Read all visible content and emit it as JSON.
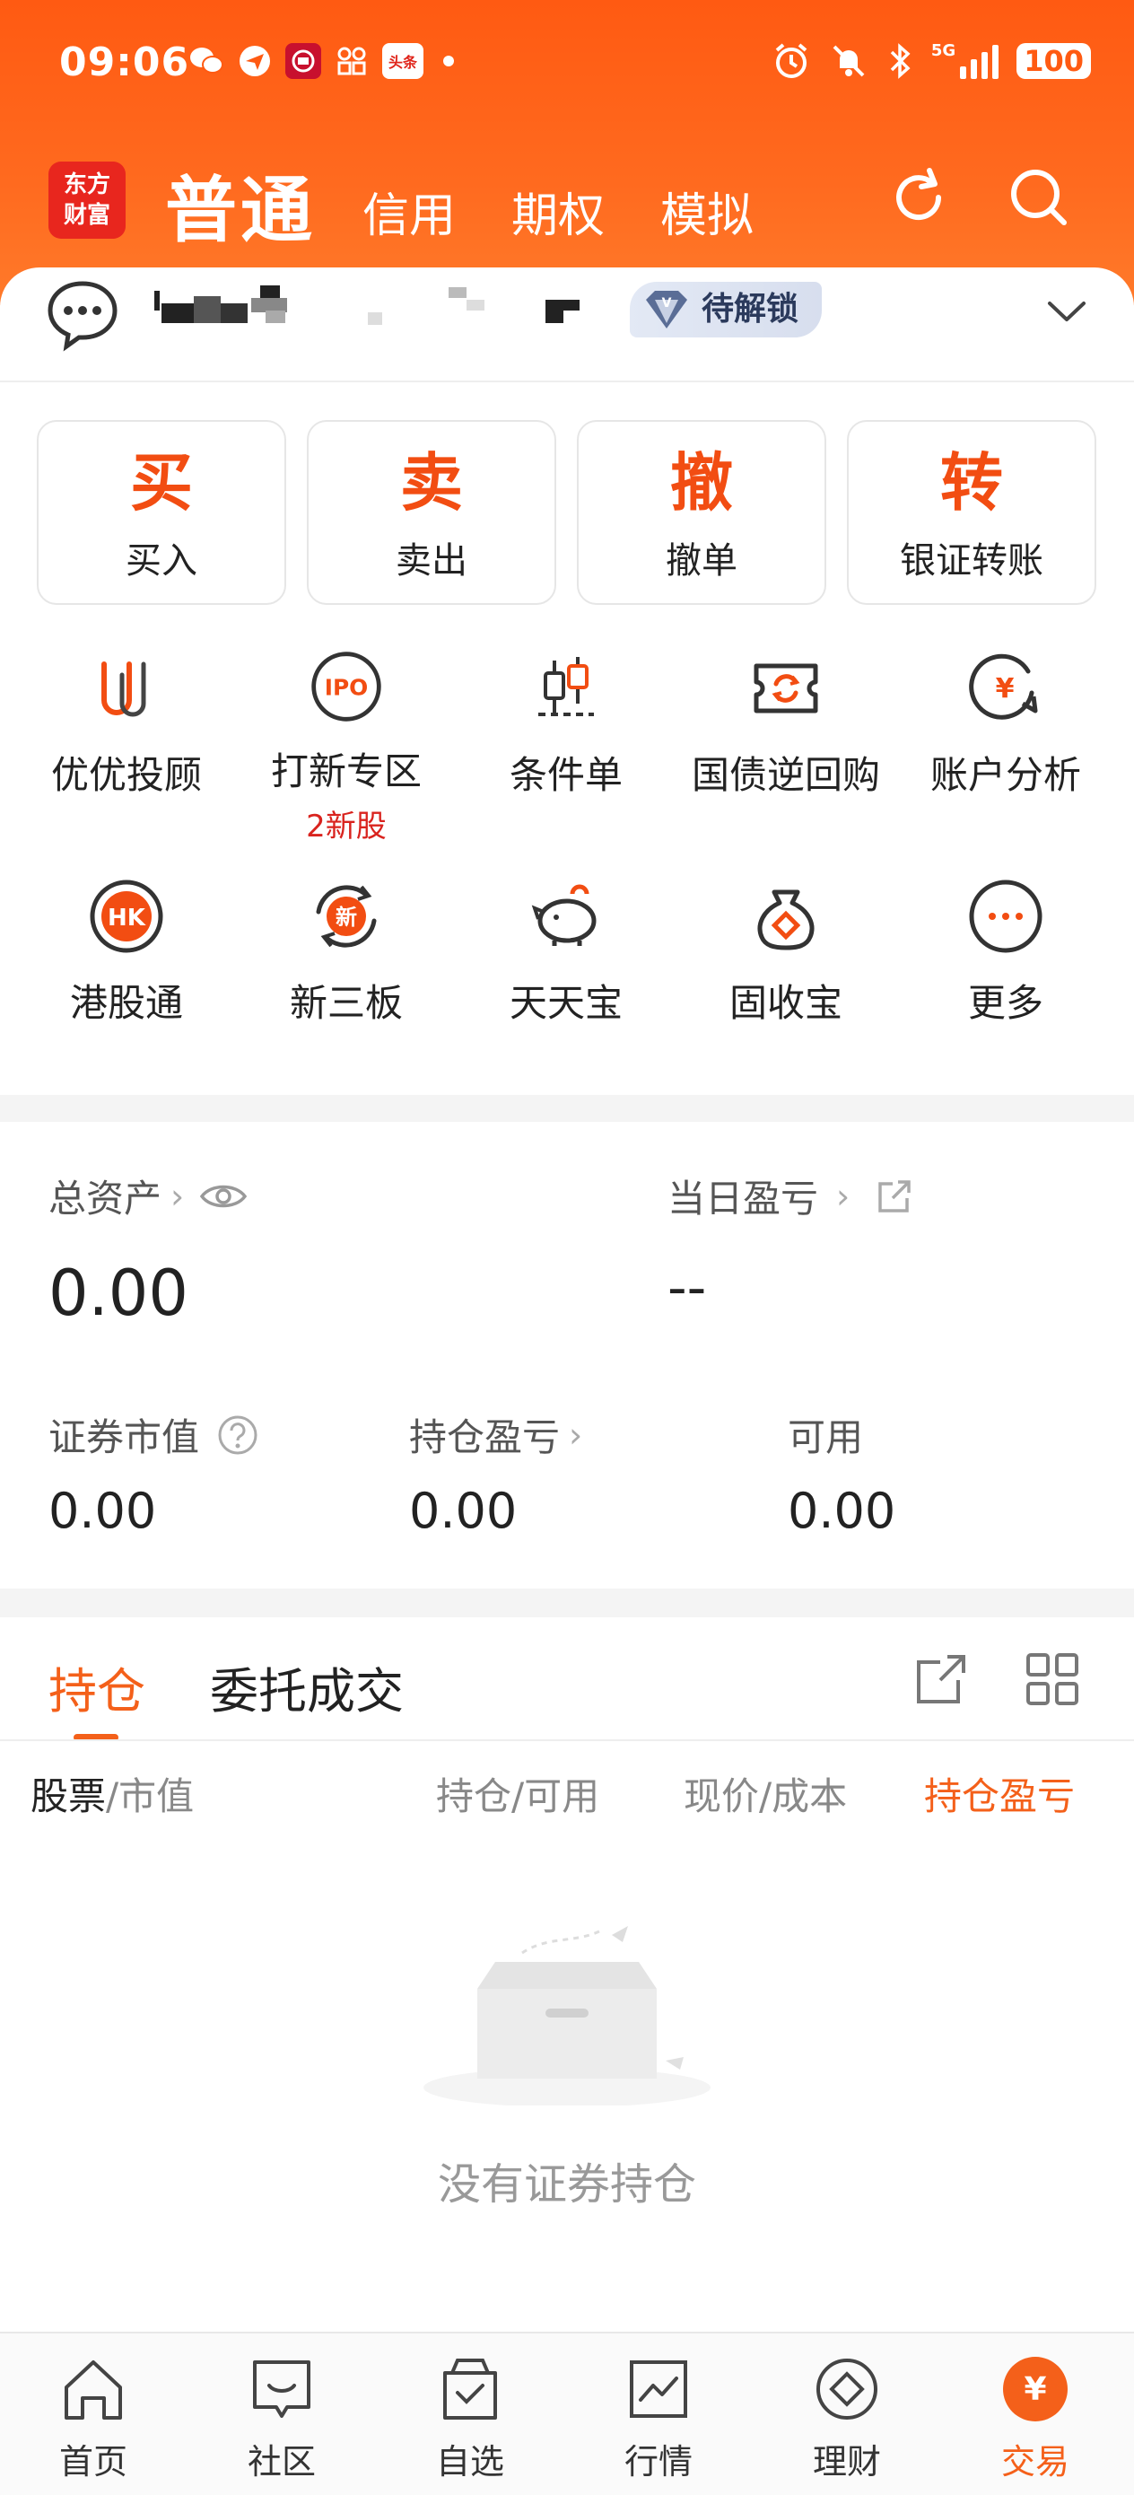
{
  "status_bar": {
    "time": "09:06",
    "news_app": "头条",
    "network": "5G",
    "battery": "100"
  },
  "header": {
    "logo_line1": "东方",
    "logo_line2": "财富",
    "tabs": [
      {
        "label": "普通",
        "active": true
      },
      {
        "label": "信用"
      },
      {
        "label": "期权"
      },
      {
        "label": "模拟"
      }
    ]
  },
  "account": {
    "badge": "待解锁"
  },
  "actions": [
    {
      "char": "买",
      "label": "买入"
    },
    {
      "char": "卖",
      "label": "卖出"
    },
    {
      "char": "撤",
      "label": "撤单"
    },
    {
      "char": "转",
      "label": "银证转账"
    }
  ],
  "services": [
    {
      "label": "优优投顾",
      "icon": "youyou-icon"
    },
    {
      "label": "打新专区",
      "icon": "ipo-icon",
      "sub": "2新股",
      "icon_text": "IPO"
    },
    {
      "label": "条件单",
      "icon": "candlestick-icon"
    },
    {
      "label": "国债逆回购",
      "icon": "ticket-icon"
    },
    {
      "label": "账户分析",
      "icon": "yen-chat-icon",
      "icon_text": "¥"
    },
    {
      "label": "港股通",
      "icon": "hk-icon",
      "icon_text": "HK"
    },
    {
      "label": "新三板",
      "icon": "new-icon",
      "icon_text": "新"
    },
    {
      "label": "天天宝",
      "icon": "piggy-icon"
    },
    {
      "label": "固收宝",
      "icon": "money-bag-icon"
    },
    {
      "label": "更多",
      "icon": "more-icon"
    }
  ],
  "assets": {
    "total_label": "总资产",
    "total_value": "0.00",
    "daily_pl_label": "当日盈亏",
    "daily_pl_value": "--",
    "market_value_label": "证券市值",
    "market_value": "0.00",
    "position_pl_label": "持仓盈亏",
    "position_pl": "0.00",
    "available_label": "可用",
    "available": "0.00"
  },
  "holdings": {
    "tabs": [
      {
        "label": "持仓",
        "active": true
      },
      {
        "label": "委托成交"
      }
    ],
    "columns": {
      "stock": "股票",
      "market_value": "/市值",
      "position": "持仓/可用",
      "price": "现价/成本",
      "pl": "持仓盈亏"
    },
    "empty_text": "没有证券持仓"
  },
  "bottom_nav": [
    {
      "label": "首页",
      "icon": "home-icon"
    },
    {
      "label": "社区",
      "icon": "community-icon"
    },
    {
      "label": "自选",
      "icon": "watchlist-icon"
    },
    {
      "label": "行情",
      "icon": "market-icon"
    },
    {
      "label": "理财",
      "icon": "wealth-icon"
    },
    {
      "label": "交易",
      "icon": "trade-icon",
      "active": true,
      "icon_text": "¥"
    }
  ],
  "colors": {
    "brand": "#ff5a12",
    "accent": "#f4601a",
    "alert": "#d9231e"
  }
}
